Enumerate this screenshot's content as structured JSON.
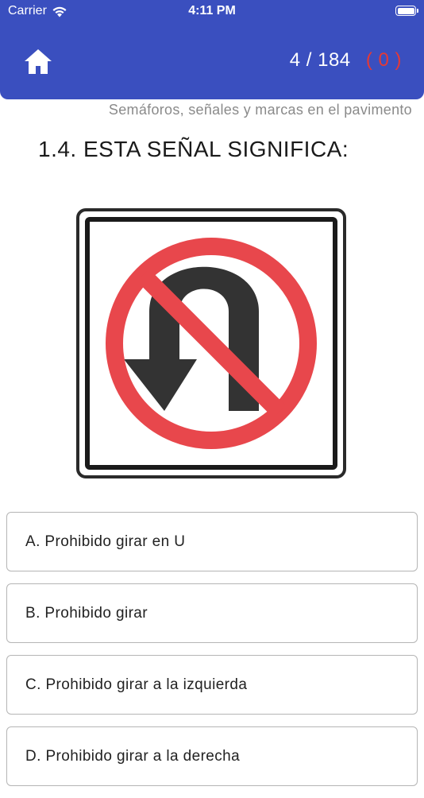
{
  "status_bar": {
    "carrier": "Carrier",
    "time": "4:11 PM"
  },
  "header": {
    "home_icon": "home-icon",
    "progress_current": "4",
    "progress_separator": "/",
    "progress_total": "184",
    "errors_label": "( 0 )"
  },
  "category": "Semáforos, señales y marcas en el pavimento",
  "question": {
    "title": "1.4. ESTA SEÑAL SIGNIFICA:",
    "image_icon": "no-u-turn-sign"
  },
  "answers": [
    {
      "label": "A. Prohibido girar en U"
    },
    {
      "label": "B. Prohibido girar"
    },
    {
      "label": "C. Prohibido girar a la izquierda"
    },
    {
      "label": "D. Prohibido girar a la derecha"
    }
  ],
  "colors": {
    "header": "#3a4fbf",
    "error": "#e53935",
    "sign_red": "#e8474c"
  }
}
